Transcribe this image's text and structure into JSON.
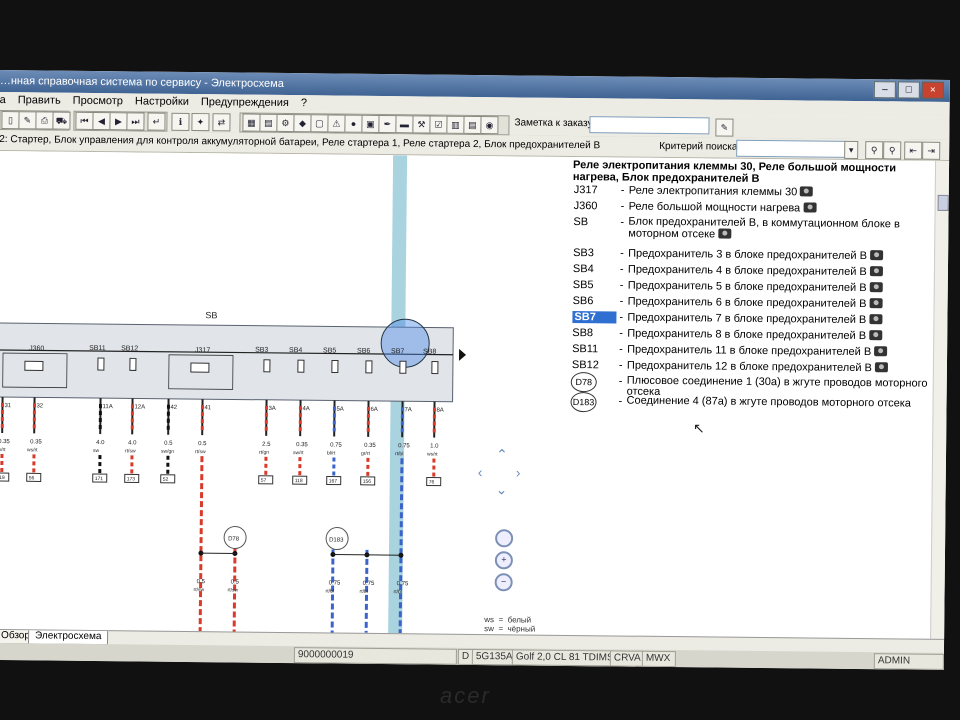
{
  "window": {
    "title": "…нная справочная система по сервису - Электросхема"
  },
  "menu": [
    "а",
    "Править",
    "Просмотр",
    "Настройки",
    "Предупреждения",
    "?"
  ],
  "toolbar": {
    "order_note_label": "Заметка к заказу:",
    "search_criteria_label": "Критерий поиска:"
  },
  "breadcrumb": "2: Стартер, Блок управления для контроля аккумуляторной батареи, Реле стартера 1, Реле стартера 2, Блок предохранителей B",
  "diagram": {
    "block_label": "SB",
    "relays": [
      "J360",
      "J317"
    ],
    "fuses": [
      "SB11",
      "SB12",
      "SB3",
      "SB4",
      "SB5",
      "SB6",
      "SB7",
      "SB8"
    ],
    "connectors": [
      "D78",
      "D183"
    ],
    "wires": [
      {
        "pin": "31",
        "size": "0.35",
        "color": "sw/rt",
        "ref": "119"
      },
      {
        "pin": "32",
        "size": "0.35",
        "color": "ws/rt",
        "ref": "56"
      },
      {
        "pin": "11A",
        "size": "4.0",
        "color": "sw",
        "ref": "171"
      },
      {
        "pin": "12A",
        "size": "4.0",
        "color": "rt/sw",
        "ref": "173"
      },
      {
        "pin": "42",
        "size": "0.5",
        "color": "sw/gn",
        "ref": "52"
      },
      {
        "pin": "41",
        "size": "0.5",
        "color": "rt/sw",
        "ref": ""
      },
      {
        "pin": "3A",
        "size": "2.5",
        "color": "rt/gn",
        "ref": "57"
      },
      {
        "pin": "4A",
        "size": "0.35",
        "color": "sw/rt",
        "ref": "118"
      },
      {
        "pin": "5A",
        "size": "0.75",
        "color": "bl/rt",
        "ref": "167"
      },
      {
        "pin": "6A",
        "size": "0.35",
        "color": "gr/rt",
        "ref": "156"
      },
      {
        "pin": "7A",
        "size": "0.75",
        "color": "rt/bl",
        "ref": ""
      },
      {
        "pin": "8A",
        "size": "1.0",
        "color": "ws/rt",
        "ref": "76"
      }
    ],
    "lower_wires": [
      {
        "size": "0.5",
        "color": "rt/sw"
      },
      {
        "size": "0.5",
        "color": "rt/sw"
      },
      {
        "size": "0.75",
        "color": "rt/bl"
      },
      {
        "size": "0.75",
        "color": "rt/bl"
      },
      {
        "size": "0.75",
        "color": "rt/bl"
      }
    ]
  },
  "legend": {
    "title": "Реле электропитания клеммы 30, Реле большой мощности нагрева, Блок предохранителей B",
    "items": [
      {
        "code": "J317",
        "desc": "Реле электропитания клеммы 30"
      },
      {
        "code": "J360",
        "desc": "Реле большой мощности нагрева"
      },
      {
        "code": "SB",
        "desc": "Блок предохранителей B, в коммутационном блоке в моторном отсеке"
      },
      {
        "code": "SB3",
        "desc": "Предохранитель 3 в блоке предохранителей B"
      },
      {
        "code": "SB4",
        "desc": "Предохранитель 4 в блоке предохранителей B"
      },
      {
        "code": "SB5",
        "desc": "Предохранитель 5 в блоке предохранителей B"
      },
      {
        "code": "SB6",
        "desc": "Предохранитель 6 в блоке предохранителей B"
      },
      {
        "code": "SB7",
        "desc": "Предохранитель 7 в блоке предохранителей B"
      },
      {
        "code": "SB8",
        "desc": "Предохранитель 8 в блоке предохранителей B"
      },
      {
        "code": "SB11",
        "desc": "Предохранитель 11 в блоке предохранителей B"
      },
      {
        "code": "SB12",
        "desc": "Предохранитель 12 в блоке предохранителей B"
      },
      {
        "code": "D78",
        "desc": "Плюсовое соединение 1 (30a) в жгуте проводов моторного отсека"
      },
      {
        "code": "D183",
        "desc": "Соединение 4 (87a) в жгуте проводов моторного отсека"
      }
    ],
    "selected": "SB7"
  },
  "color_key": [
    {
      "abbr": "ws",
      "name": "белый"
    },
    {
      "abbr": "sw",
      "name": "чёрный"
    }
  ],
  "tabs": [
    "Обзор",
    "Электросхема"
  ],
  "status": {
    "doc_id": "9000000019",
    "field_d": "D",
    "code": "5G135A",
    "vehicle": "Golf 2,0 CL 81 TDIMSF",
    "engine": "CRVA",
    "gearbox": "MWX",
    "user": "ADMIN"
  },
  "brand": "acer",
  "colors": {
    "accent": "#2f6fd1",
    "highlight_column": "#a9d3df",
    "wire_red": "#d93a2a",
    "wire_blue": "#3b63c9"
  }
}
